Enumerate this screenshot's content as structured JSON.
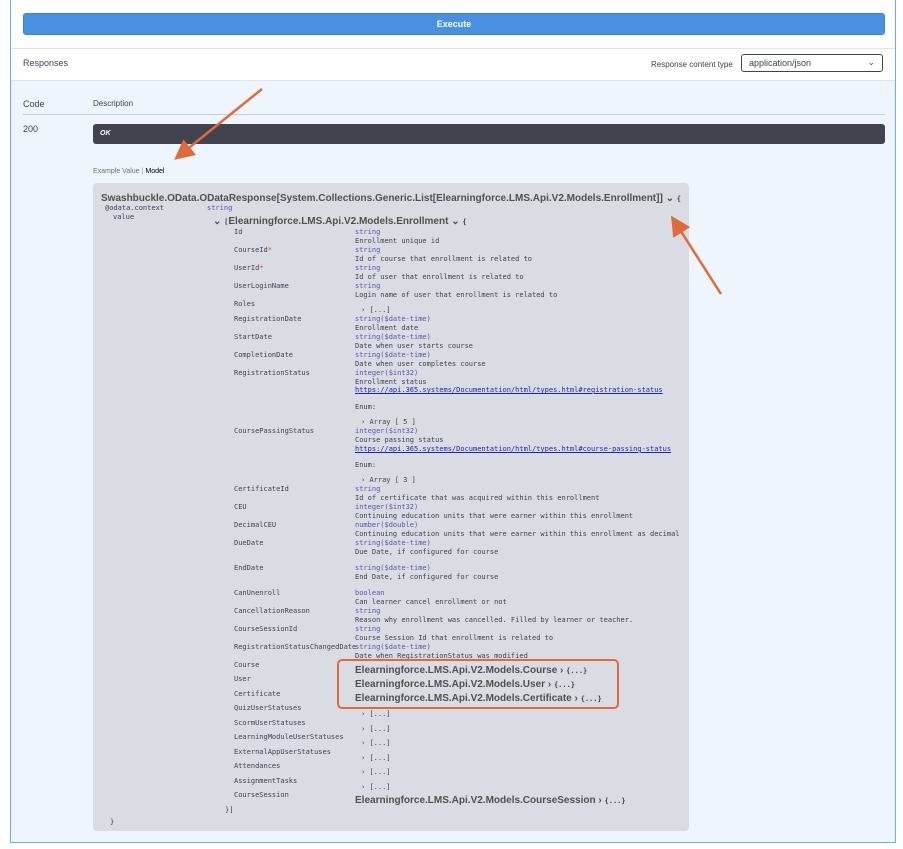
{
  "execute": {
    "label": "Execute"
  },
  "responses": {
    "title": "Responses",
    "content_type_label": "Response content type",
    "content_type_value": "application/json"
  },
  "table": {
    "code_header": "Code",
    "description_header": "Description"
  },
  "response": {
    "code": "200",
    "status": "OK"
  },
  "tabs": {
    "example": "Example Value",
    "separator": "|",
    "model": "Model"
  },
  "model": {
    "title": "Swashbuckle.OData.ODataResponse[System.Collections.Generic.List[Elearningforce.LMS.Api.V2.Models.Enrollment]]",
    "open_brace": "{",
    "close_brace": "}",
    "context_name": "@odata.context",
    "context_type": "string",
    "value_name": "value",
    "enrollment_title": "Elearningforce.LMS.Api.V2.Models.Enrollment",
    "array_open": "[",
    "array_close": "}]",
    "collapsed": "[...]",
    "enum_label": "Enum:",
    "array5": "Array [ 5 ]",
    "array3": "Array [ 3 ]",
    "obj_collapsed": "{...}",
    "props": {
      "Id": {
        "name": "Id",
        "type": "string",
        "desc": "Enrollment unique id"
      },
      "CourseId": {
        "name": "CourseId",
        "req": "*",
        "type": "string",
        "desc": "Id of course that enrollment is related to"
      },
      "UserId": {
        "name": "UserId",
        "req": "*",
        "type": "string",
        "desc": "Id of user that enrollment is related to"
      },
      "UserLoginName": {
        "name": "UserLoginName",
        "type": "string",
        "desc": "Login name of user that enrollment is related to"
      },
      "Roles": {
        "name": "Roles"
      },
      "RegistrationDate": {
        "name": "RegistrationDate",
        "type": "string($date-time)",
        "desc": "Enrollment date"
      },
      "StartDate": {
        "name": "StartDate",
        "type": "string($date-time)",
        "desc": "Date when user starts course"
      },
      "CompletionDate": {
        "name": "CompletionDate",
        "type": "string($date-time)",
        "desc": "Date when user completes course"
      },
      "RegistrationStatus": {
        "name": "RegistrationStatus",
        "type": "integer($int32)",
        "desc": "Enrollment status",
        "link": "https://api.365.systems/Documentation/html/types.html#registration-status"
      },
      "CoursePassingStatus": {
        "name": "CoursePassingStatus",
        "type": "integer($int32)",
        "desc": "Course passing status",
        "link": "https://api.365.systems/Documentation/html/types.html#course-passing-status"
      },
      "CertificateId": {
        "name": "CertificateId",
        "type": "string",
        "desc": "Id of certificate that was acquired within this enrollment"
      },
      "CEU": {
        "name": "CEU",
        "type": "integer($int32)",
        "desc": "Continuing education units that were earner within this enrollment"
      },
      "DecimalCEU": {
        "name": "DecimalCEU",
        "type": "number($double)",
        "desc": "Continuing education units that were earner within this enrollment as decimal"
      },
      "DueDate": {
        "name": "DueDate",
        "type": "string($date-time)",
        "desc": "Due Date, if configured for course"
      },
      "EndDate": {
        "name": "EndDate",
        "type": "string($date-time)",
        "desc": "End Date, if configured for course"
      },
      "CanUnenroll": {
        "name": "CanUnenroll",
        "type": "boolean",
        "desc": "Can learner cancel enrollment or not"
      },
      "CancellationReason": {
        "name": "CancellationReason",
        "type": "string",
        "desc": "Reason why enrollment was cancelled. Filled by learner or teacher."
      },
      "CourseSessionId": {
        "name": "CourseSessionId",
        "type": "string",
        "desc": "Course Session Id that enrollment is related to"
      },
      "RegistrationStatusChangedDate": {
        "name": "RegistrationStatusChangedDate",
        "type": "string($date-time)",
        "desc": "Date when RegistrationStatus was modified"
      },
      "Course": {
        "name": "Course",
        "ref": "Elearningforce.LMS.Api.V2.Models.Course"
      },
      "User": {
        "name": "User",
        "ref": "Elearningforce.LMS.Api.V2.Models.User"
      },
      "Certificate": {
        "name": "Certificate",
        "ref": "Elearningforce.LMS.Api.V2.Models.Certificate"
      },
      "QuizUserStatuses": {
        "name": "QuizUserStatuses"
      },
      "ScormUserStatuses": {
        "name": "ScormUserStatuses"
      },
      "LearningModuleUserStatuses": {
        "name": "LearningModuleUserStatuses"
      },
      "ExternalAppUserStatuses": {
        "name": "ExternalAppUserStatuses"
      },
      "Attendances": {
        "name": "Attendances"
      },
      "AssignmentTasks": {
        "name": "AssignmentTasks"
      },
      "CourseSession": {
        "name": "CourseSession",
        "ref": "Elearningforce.LMS.Api.V2.Models.CourseSession"
      }
    }
  },
  "colors": {
    "accent": "#4990e2",
    "frame_border": "#61affe",
    "ok_bar": "#41444e",
    "annotation": "#e06a3b",
    "model_bg": "#d9dce2"
  }
}
